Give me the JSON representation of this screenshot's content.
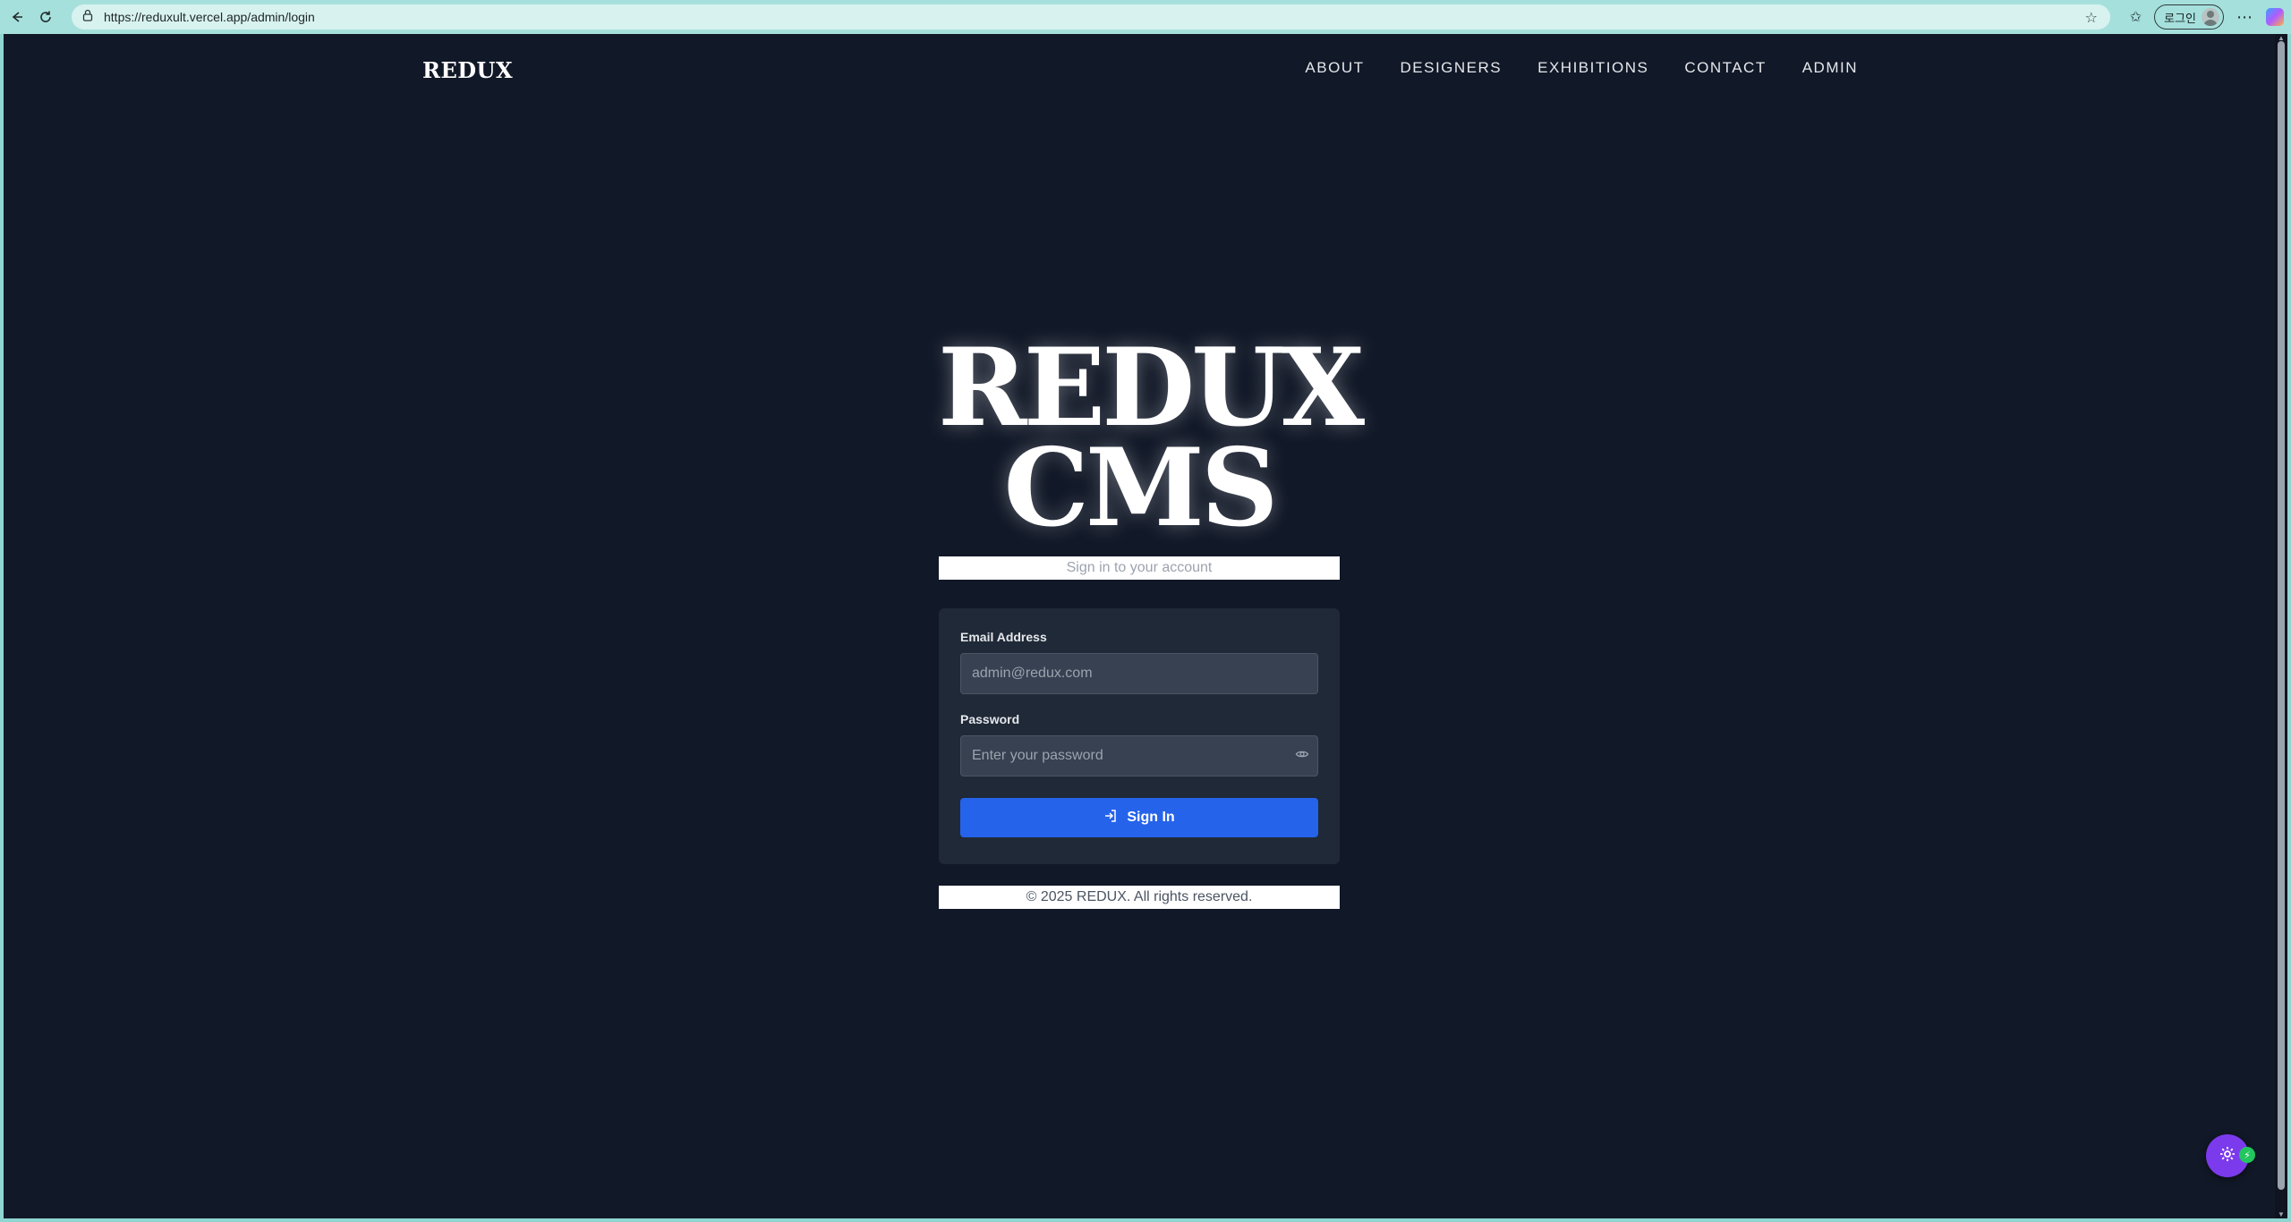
{
  "browser": {
    "url": "https://reduxult.vercel.app/admin/login",
    "profile_label": "로그인",
    "more_label": "⋯"
  },
  "header": {
    "brand": "REDUX",
    "nav": [
      "ABOUT",
      "DESIGNERS",
      "EXHIBITIONS",
      "CONTACT",
      "ADMIN"
    ]
  },
  "hero": {
    "title_line1": "REDUX",
    "title_line2": "CMS",
    "subtitle": "Sign in to your account"
  },
  "form": {
    "email_label": "Email Address",
    "email_placeholder": "admin@redux.com",
    "password_label": "Password",
    "password_placeholder": "Enter your password",
    "submit_label": "Sign In"
  },
  "footer": {
    "copyright": "© 2025 REDUX. All rights reserved."
  },
  "colors": {
    "page_bg": "#111827",
    "card_bg": "#1f2937",
    "primary": "#2563eb",
    "fab": "#7c3aed",
    "fab_badge": "#22c55e"
  },
  "icons": {
    "back": "back-arrow-icon",
    "reload": "reload-icon",
    "lock": "lock-icon",
    "star": "star-icon",
    "favorites": "favorites-icon",
    "eye": "eye-icon",
    "signin": "sign-in-icon",
    "gear": "gear-icon",
    "bolt": "bolt-icon"
  }
}
